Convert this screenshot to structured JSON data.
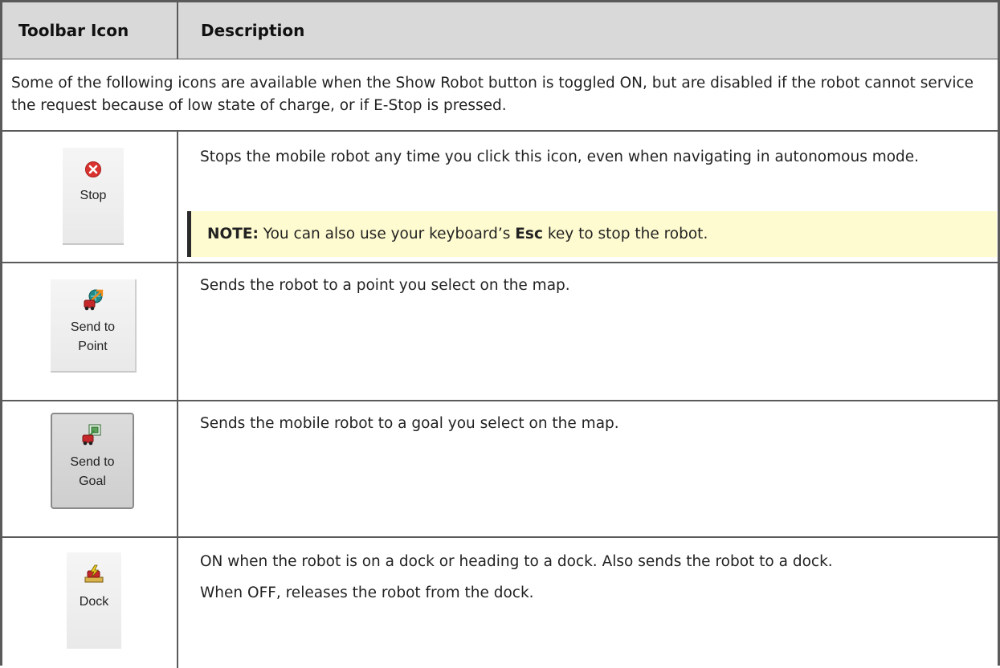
{
  "table": {
    "header": {
      "col1": "Toolbar Icon",
      "col2": "Description"
    },
    "intro": "Some of the following icons are available when the Show Robot button is toggled ON, but are disabled if the robot cannot service the request because of low state of charge, or if E-Stop is pressed.",
    "rows": [
      {
        "icon_label": "Stop",
        "icon_name": "stop-icon",
        "description": "Stops the mobile robot any time you click this icon, even when navigating in autonomous mode.",
        "note_prefix": "NOTE:",
        "note_text_1": "You can also use your keyboard’s",
        "note_key": "Esc",
        "note_text_2": "key to stop the robot."
      },
      {
        "icon_label": "Send to\nPoint",
        "icon_name": "send-to-point-icon",
        "description": "Sends the robot to a point you select on the map."
      },
      {
        "icon_label": "Send to\nGoal",
        "icon_name": "send-to-goal-icon",
        "description": "Sends the mobile robot to a goal you select on the map."
      },
      {
        "icon_label": "Dock",
        "icon_name": "dock-icon",
        "description": "ON when the robot is on a dock or heading to a dock. Also sends the robot to a dock.",
        "description_2": "When OFF, releases the robot from the dock."
      }
    ]
  },
  "colors": {
    "header_bg": "#d9d9d9",
    "note_bg": "#fffbd0",
    "border": "#5a5a5a",
    "stop_red": "#d9322f"
  }
}
